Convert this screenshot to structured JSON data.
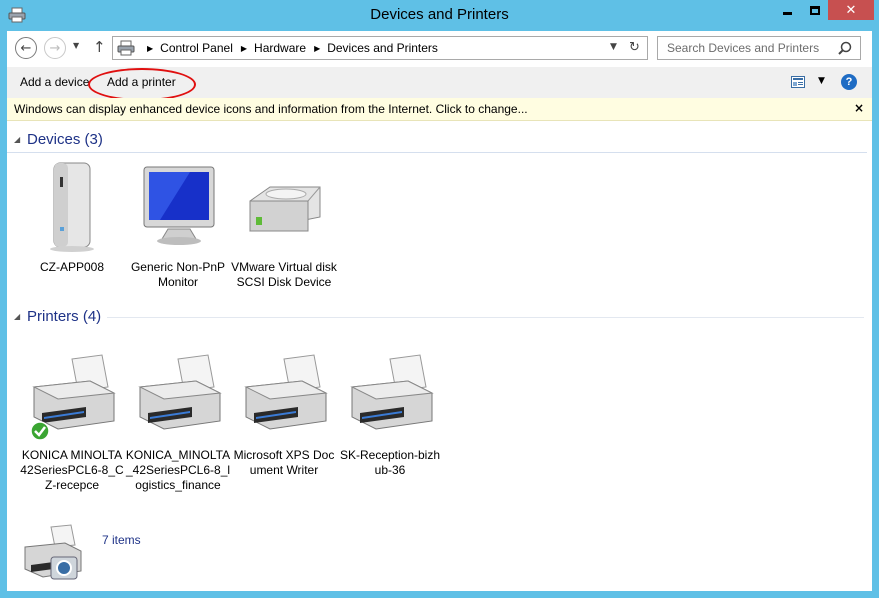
{
  "window": {
    "title": "Devices and Printers"
  },
  "nav": {
    "breadcrumbs": [
      "Control Panel",
      "Hardware",
      "Devices and Printers"
    ],
    "search_placeholder": "Search Devices and Printers"
  },
  "toolbar": {
    "add_device": "Add a device",
    "add_printer": "Add a printer"
  },
  "infobar": {
    "message": "Windows can display enhanced device icons and information from the Internet. Click to change...",
    "close": "×"
  },
  "groups": {
    "devices": {
      "label": "Devices (3)",
      "items": [
        {
          "name": "CZ-APP008",
          "icon": "pc-tower-icon"
        },
        {
          "name": "Generic Non-PnP Monitor",
          "icon": "monitor-icon"
        },
        {
          "name": "VMware Virtual disk SCSI Disk Device",
          "icon": "disk-drive-icon"
        }
      ]
    },
    "printers": {
      "label": "Printers (4)",
      "items": [
        {
          "name": "KONICA MINOLTA 42SeriesPCL6-8_CZ-recepce",
          "icon": "printer-icon",
          "default": true
        },
        {
          "name": "KONICA_MINOLTA_42SeriesPCL6-8_logistics_finance",
          "icon": "printer-icon"
        },
        {
          "name": "Microsoft XPS Document Writer",
          "icon": "printer-icon"
        },
        {
          "name": "SK-Reception-bizhub-36",
          "icon": "printer-icon"
        }
      ]
    }
  },
  "status": {
    "count": "7 items"
  },
  "colors": {
    "window_frame": "#5fc0e6",
    "group_header": "#1e3287",
    "close_button": "#c75050",
    "highlight_oval": "#e01010"
  }
}
